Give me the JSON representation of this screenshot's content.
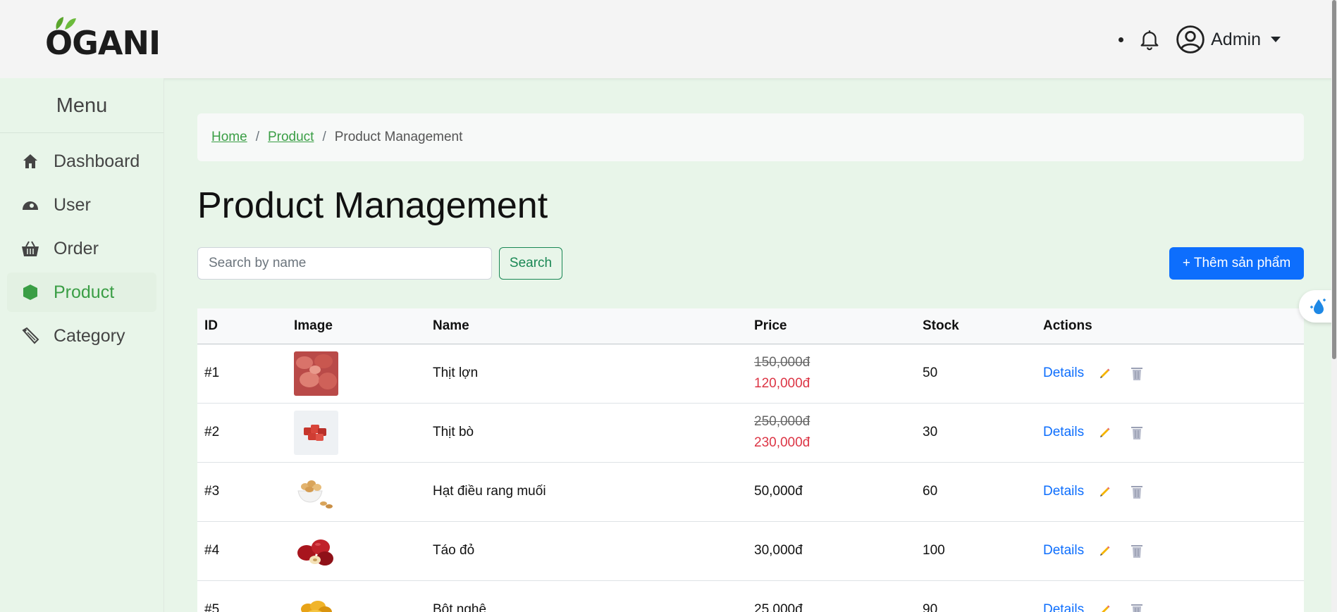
{
  "header": {
    "logo_text": "OGANI",
    "admin_name": "Admin"
  },
  "sidebar": {
    "title": "Menu",
    "items": [
      {
        "label": "Dashboard",
        "icon": "home-icon",
        "active": false
      },
      {
        "label": "User",
        "icon": "user-icon",
        "active": false
      },
      {
        "label": "Order",
        "icon": "basket-icon",
        "active": false
      },
      {
        "label": "Product",
        "icon": "box-icon",
        "active": true
      },
      {
        "label": "Category",
        "icon": "tag-icon",
        "active": false
      }
    ]
  },
  "breadcrumb": {
    "home": "Home",
    "product": "Product",
    "current": "Product Management",
    "separator": "/"
  },
  "page": {
    "title": "Product Management",
    "search_placeholder": "Search by name",
    "search_button": "Search",
    "add_button": "+ Thêm sản phẩm"
  },
  "table": {
    "headers": [
      "ID",
      "Image",
      "Name",
      "Price",
      "Stock",
      "Actions"
    ],
    "details_label": "Details",
    "rows": [
      {
        "id": "#1",
        "name": "Thịt lợn",
        "old_price": "150,000đ",
        "price": "120,000đ",
        "stock": "50",
        "image": "pork-image"
      },
      {
        "id": "#2",
        "name": "Thịt bò",
        "old_price": "250,000đ",
        "price": "230,000đ",
        "stock": "30",
        "image": "beef-image"
      },
      {
        "id": "#3",
        "name": "Hạt điều rang muối",
        "old_price": "",
        "price": "50,000đ",
        "stock": "60",
        "image": "cashew-image"
      },
      {
        "id": "#4",
        "name": "Táo đỏ",
        "old_price": "",
        "price": "30,000đ",
        "stock": "100",
        "image": "jujube-image"
      },
      {
        "id": "#5",
        "name": "Bột nghệ",
        "old_price": "",
        "price": "25,000đ",
        "stock": "90",
        "image": "turmeric-image"
      }
    ]
  },
  "colors": {
    "accent_green": "#3a9e45",
    "primary_blue": "#0d6efd",
    "sale_red": "#dc3545",
    "sidebar_bg": "#e8f5e9"
  }
}
